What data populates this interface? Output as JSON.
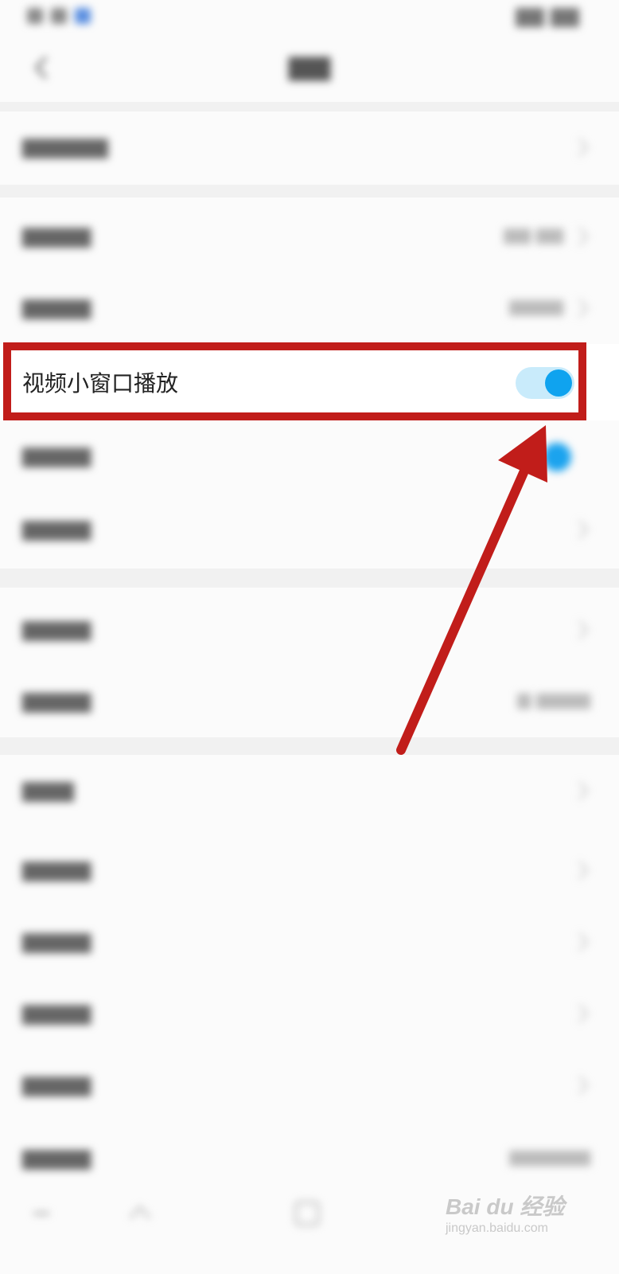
{
  "highlighted_setting": {
    "label": "视频小窗口播放",
    "toggle_on": true
  },
  "colors": {
    "accent": "#0fa3ef",
    "annotation": "#c11d1a"
  },
  "watermark": {
    "brand": "Bai du 经验",
    "sub": "jingyan.baidu.com"
  }
}
